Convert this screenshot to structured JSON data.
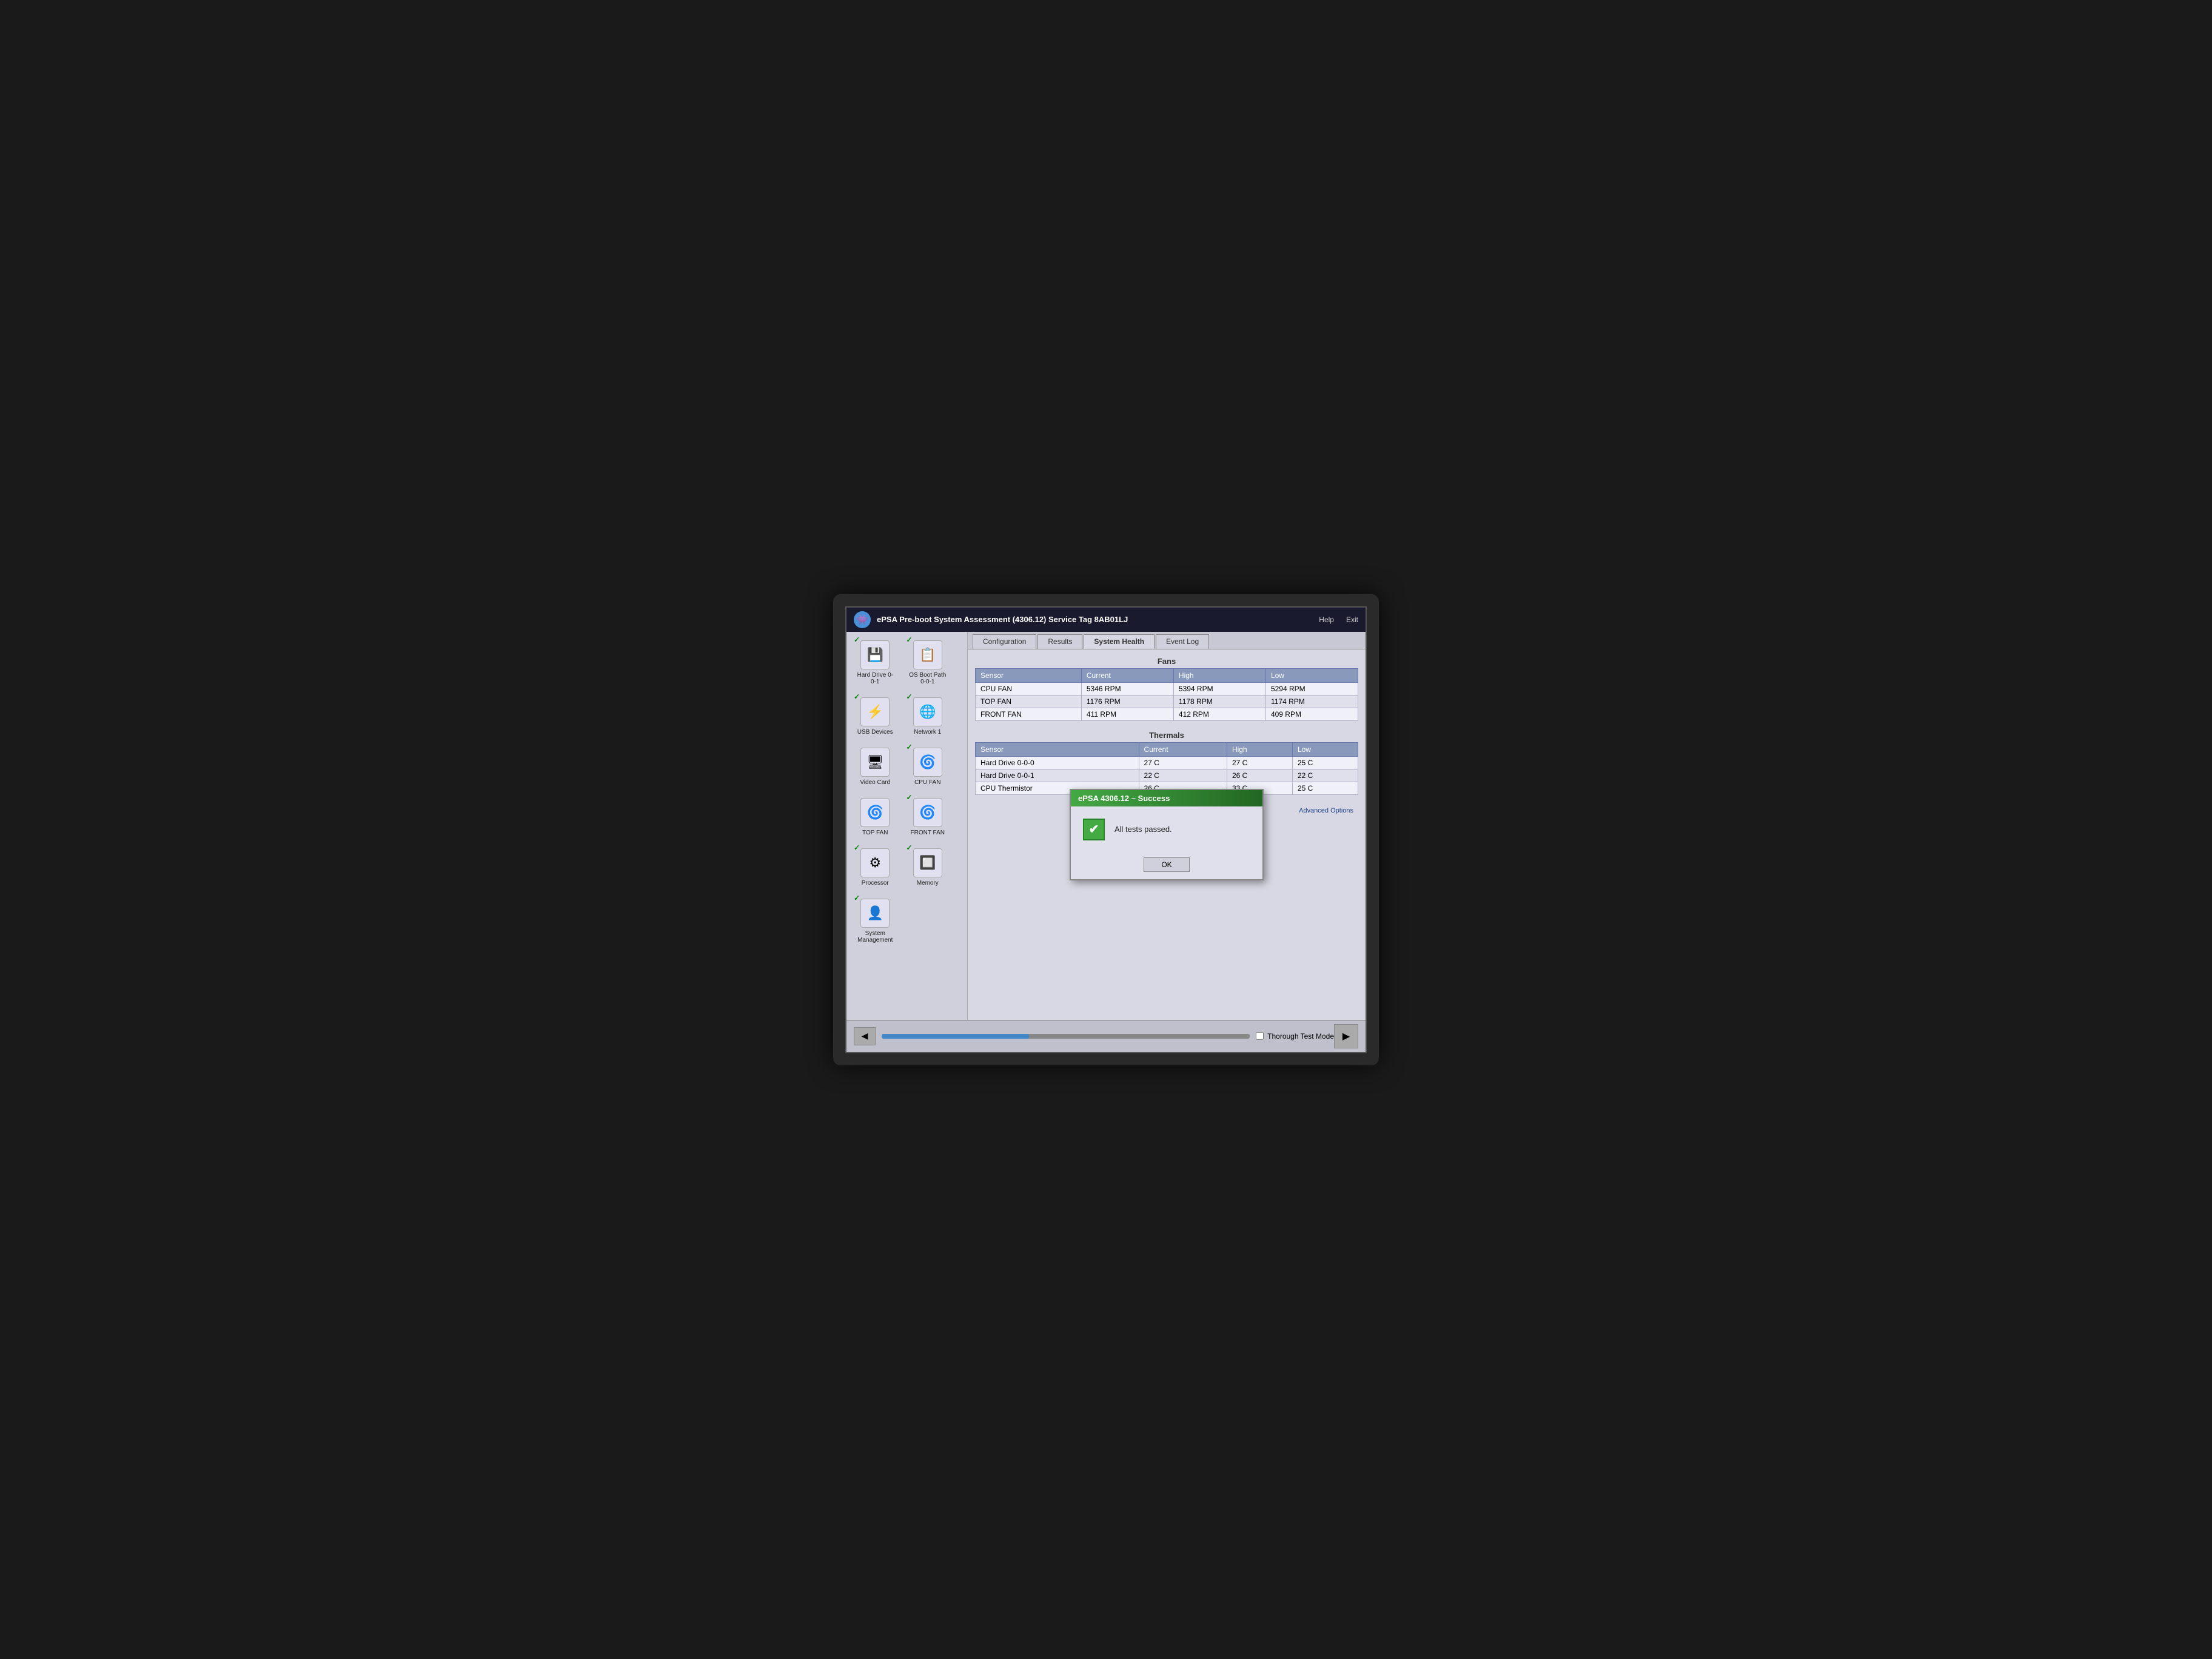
{
  "titleBar": {
    "title": "ePSA Pre-boot System Assessment (4306.12)  Service Tag 8AB01LJ",
    "helpLabel": "Help",
    "exitLabel": "Exit"
  },
  "tabs": [
    {
      "label": "Configuration",
      "active": false
    },
    {
      "label": "Results",
      "active": false
    },
    {
      "label": "System Health",
      "active": true
    },
    {
      "label": "Event Log",
      "active": false
    }
  ],
  "sidebar": {
    "devices": [
      {
        "label": "Hard Drive 0-0-1",
        "icon": "💾",
        "checked": true
      },
      {
        "label": "OS Boot Path 0-0-1",
        "icon": "📋",
        "checked": true
      },
      {
        "label": "USB Devices",
        "icon": "⚡",
        "checked": true
      },
      {
        "label": "Network 1",
        "icon": "🌐",
        "checked": true
      },
      {
        "label": "Video Card",
        "icon": "🖥",
        "checked": false
      },
      {
        "label": "CPU FAN",
        "icon": "🌀",
        "checked": true
      },
      {
        "label": "TOP FAN",
        "icon": "🌀",
        "checked": false
      },
      {
        "label": "FRONT FAN",
        "icon": "🌀",
        "checked": true
      },
      {
        "label": "Processor",
        "icon": "⚙",
        "checked": true
      },
      {
        "label": "Memory",
        "icon": "🔲",
        "checked": true
      },
      {
        "label": "System Management",
        "icon": "👤",
        "checked": true
      }
    ],
    "footerLabel": "System Management"
  },
  "fans": {
    "sectionTitle": "Fans",
    "headers": [
      "Sensor",
      "Current",
      "High",
      "Low"
    ],
    "rows": [
      [
        "CPU FAN",
        "5346 RPM",
        "5394 RPM",
        "5294 RPM"
      ],
      [
        "TOP FAN",
        "1176 RPM",
        "1178 RPM",
        "1174 RPM"
      ],
      [
        "FRONT FAN",
        "411 RPM",
        "412 RPM",
        "409 RPM"
      ]
    ]
  },
  "thermals": {
    "sectionTitle": "Thermals",
    "headers": [
      "Sensor",
      "Current",
      "High",
      "Low"
    ],
    "rows": [
      [
        "Hard Drive 0-0-0",
        "27 C",
        "27 C",
        "25 C"
      ],
      [
        "Hard Drive 0-0-1",
        "22 C",
        "26 C",
        "22 C"
      ],
      [
        "CPU Thermistor",
        "26 C",
        "33 C",
        "25 C"
      ]
    ]
  },
  "modal": {
    "title": "ePSA 4306.12 – Success",
    "message": "All tests passed.",
    "okLabel": "OK"
  },
  "bottomBar": {
    "thoroughLabel": "Thorough Test Mode",
    "advancedLabel": "Advanced Options"
  }
}
